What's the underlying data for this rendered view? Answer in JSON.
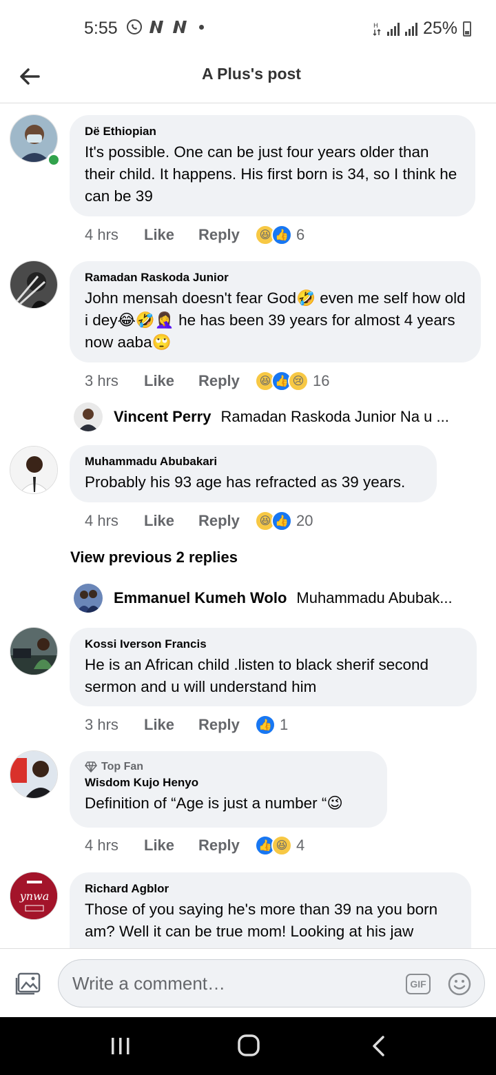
{
  "status": {
    "time": "5:55",
    "battery": "25%"
  },
  "header": {
    "title": "A Plus's post"
  },
  "comments": [
    {
      "name": "Dë Ethiopian",
      "text": "It's possible. One can be just four years older than their child. It happens. His first born is 34, so I think he can be 39",
      "time": "4 hrs",
      "like": "Like",
      "reply": "Reply",
      "reactions": [
        "haha",
        "like"
      ],
      "count": "6"
    },
    {
      "name": "Ramadan Raskoda Junior",
      "text": "John mensah doesn't fear God🤣 even me self how old i dey😂🤣🤦‍♀️ he has been 39 years for almost 4 years now aaba🙄",
      "time": "3 hrs",
      "like": "Like",
      "reply": "Reply",
      "reactions": [
        "haha",
        "like",
        "sad"
      ],
      "count": "16"
    },
    {
      "name": "Muhammadu Abubakari",
      "text": "Probably his 93 age has refracted as 39 years.",
      "time": "4 hrs",
      "like": "Like",
      "reply": "Reply",
      "reactions": [
        "haha",
        "like"
      ],
      "count": "20"
    },
    {
      "name": "Kossi Iverson Francis",
      "text": "He is  an African child .listen to black sherif second sermon and u will understand him",
      "time": "3 hrs",
      "like": "Like",
      "reply": "Reply",
      "reactions": [
        "like"
      ],
      "count": "1"
    },
    {
      "badge": "Top Fan",
      "name": "Wisdom Kujo Henyo",
      "text": "Definition of “Age is just a number “😉",
      "time": "4 hrs",
      "like": "Like",
      "reply": "Reply",
      "reactions": [
        "like",
        "haha"
      ],
      "count": "4"
    },
    {
      "name": "Richard Agblor",
      "text": "Those of you saying he's more than 39 na you born am? Well it can be true mom! Looking at his jaw"
    }
  ],
  "replies": [
    {
      "name": "Vincent Perry",
      "text": "Ramadan Raskoda Junior Na u ..."
    },
    {
      "name": "Emmanuel Kumeh Wolo",
      "text": "Muhammadu Abubak..."
    }
  ],
  "view_previous": "View previous 2 replies",
  "composer": {
    "placeholder": "Write a comment…",
    "gif_label": "GIF"
  },
  "avatar_logo_text": "ynwa",
  "colors": {
    "like_blue": "#1877f2",
    "haha_yellow": "#f7c844",
    "bubble": "#f0f2f5",
    "online": "#31a24c"
  }
}
